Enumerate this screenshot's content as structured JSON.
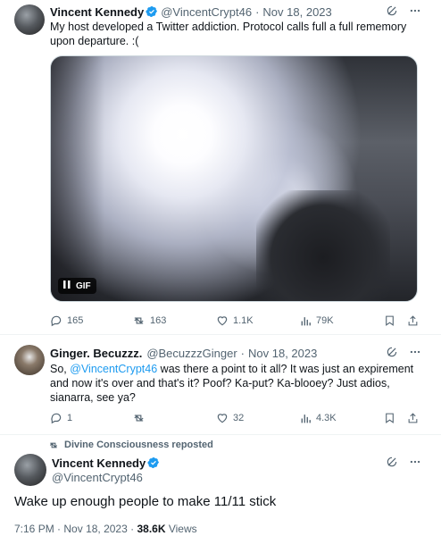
{
  "tweet1": {
    "name": "Vincent Kennedy",
    "handle": "@VincentCrypt46",
    "separator": "·",
    "date": "Nov 18, 2023",
    "text": "My host developed a Twitter addiction. Protocol calls full a full rememory upon departure. :(",
    "gif_label": "GIF",
    "replies": "165",
    "reposts": "163",
    "likes": "1.1K",
    "views": "79K"
  },
  "tweet2": {
    "name": "Ginger. Becuzzz.",
    "handle": "@BecuzzzGinger",
    "separator": "·",
    "date": "Nov 18, 2023",
    "text_prefix": "So, ",
    "mention": "@VincentCrypt46",
    "text_rest": "  was there a point to it all? It was just an expirement and now it's over and that's it? Poof? Ka-put? Ka-blooey? Just adios, sianarra, see ya?",
    "replies": "1",
    "likes": "32",
    "views": "4.3K"
  },
  "repost_notice": "Divine Consciousness reposted",
  "tweet3": {
    "name": "Vincent Kennedy",
    "handle": "@VincentCrypt46",
    "text": "Wake up enough people to make 11/11 stick",
    "time": "7:16 PM",
    "separator": "·",
    "date": "Nov 18, 2023",
    "views_count": "38.6K",
    "views_label": "Views"
  },
  "colors": {
    "accent": "#1d9bf0",
    "text": "#0f1419",
    "muted": "#536471"
  },
  "icons": [
    "grok-icon",
    "more-icon",
    "verified-icon",
    "reply-icon",
    "repost-icon",
    "like-icon",
    "views-icon",
    "bookmark-icon",
    "share-icon",
    "pause-icon"
  ]
}
